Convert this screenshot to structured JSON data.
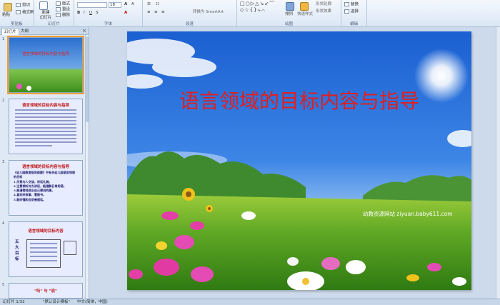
{
  "ribbon": {
    "groups": {
      "clipboard": "剪贴板",
      "slides": "幻灯片",
      "font": "字体",
      "paragraph": "段落",
      "drawing": "绘图",
      "editing": "编辑"
    },
    "paste_label": "粘贴",
    "cut_label": "剪切",
    "format_painter_label": "格式刷",
    "new_slide_label": "新建\n幻灯片",
    "layout_label": "版式",
    "reset_label": "重设",
    "delete_label": "删除",
    "font_size_value": "18",
    "convert_smartart_label": "转换为 SmartArt",
    "arrange_label": "排列",
    "quick_styles_label": "快速样式",
    "shape_fill_label": "形状轮廓",
    "shape_effects_label": "形状效果",
    "replace_label": "替换",
    "select_label": "选择"
  },
  "panel": {
    "tab_slides": "幻灯片",
    "tab_outline": "大纲",
    "close_glyph": "×",
    "thumbnails": [
      {
        "num": "1",
        "title": "语言领域的目标内容与指导"
      },
      {
        "num": "2",
        "title": "语言领域的目标内容与指导"
      },
      {
        "num": "3",
        "title": "语言领域的目标内容与指导",
        "body": "《幼儿园教育指导纲要》中有关幼儿园语言领域的目标\n1.乐意与人交谈，讲话礼貌。\n2.注意倾听对方讲话，能理解日常用语。\n3.能清楚地说出自己想说的事。\n4.喜欢听故事、看图书。\n5.能听懂和会说普通话。"
      },
      {
        "num": "4",
        "title": "语言领域的目标内容",
        "side": "五\n大\n目\n标"
      },
      {
        "num": "5",
        "title": "\"听\" 与 \"说\""
      }
    ]
  },
  "slide": {
    "title": "语言领域的目标内容与指导",
    "watermark": "幼教资源网站  ziyuan.baby611.com"
  },
  "status": {
    "slide_counter": "幻灯片 1/32",
    "theme": "\"默认设计模板\"",
    "language": "中文(简体，中国)"
  },
  "colors": {
    "title_red": "#e01f1f",
    "ribbon_bg": "#dbe7f5",
    "selected_outline": "#f0a030"
  }
}
